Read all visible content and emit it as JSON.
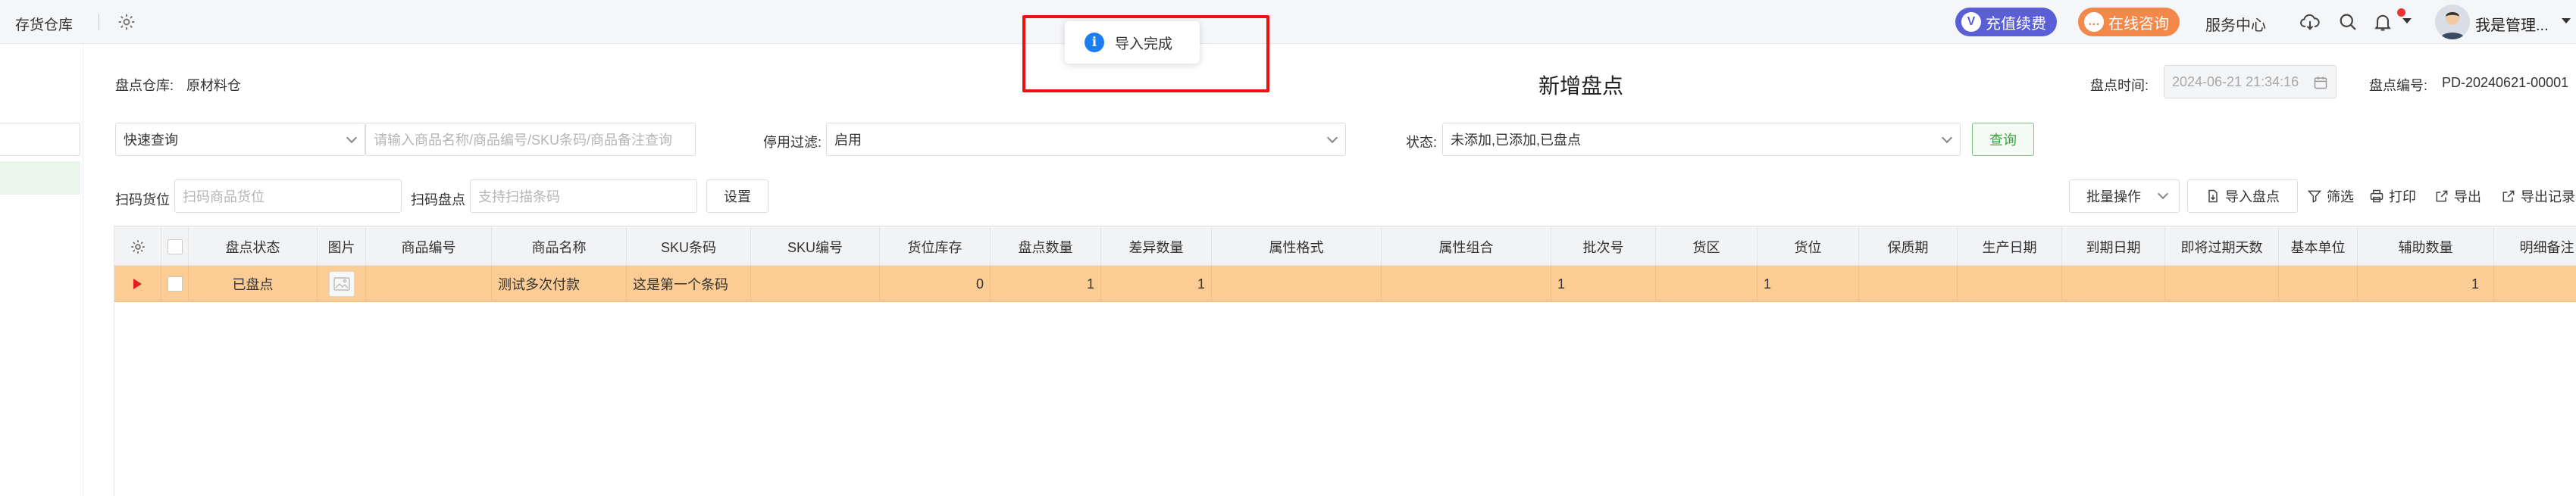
{
  "topbar": {
    "app_title": "存货仓库",
    "recharge_label": "充值续费",
    "chat_label": "在线咨询",
    "service_label": "服务中心",
    "user_name": "我是管理..."
  },
  "toast": {
    "message": "导入完成"
  },
  "header": {
    "page_title": "新增盘点",
    "warehouse_label": "盘点仓库:",
    "warehouse_value": "原材料仓",
    "time_label": "盘点时间:",
    "time_value": "2024-06-21 21:34:16",
    "code_label": "盘点编号:",
    "code_value": "PD-20240621-00001"
  },
  "filters": {
    "quick_query_value": "快速查询",
    "search_placeholder": "请输入商品名称/商品编号/SKU条码/商品备注查询",
    "disabled_filter_label": "停用过滤:",
    "disabled_filter_value": "启用",
    "status_label": "状态:",
    "status_value": "未添加,已添加,已盘点",
    "query_button": "查询"
  },
  "scan": {
    "location_label": "扫码货位",
    "location_placeholder": "扫码商品货位",
    "scan_label": "扫码盘点",
    "scan_placeholder": "支持扫描条码",
    "settings_button": "设置"
  },
  "toolbar": {
    "batch_label": "批量操作",
    "import_label": "导入盘点",
    "filter_label": "筛选",
    "print_label": "打印",
    "export_label": "导出",
    "export_record_label": "导出记录"
  },
  "table": {
    "headers": {
      "status": "盘点状态",
      "image": "图片",
      "code": "商品编号",
      "name": "商品名称",
      "sku_barcode": "SKU条码",
      "sku_code": "SKU编号",
      "stock": "货位库存",
      "count": "盘点数量",
      "diff": "差异数量",
      "attr_spec": "属性格式",
      "attr_combo": "属性组合",
      "batch": "批次号",
      "area": "货区",
      "location": "货位",
      "shelf_life": "保质期",
      "prod_date": "生产日期",
      "expire_date": "到期日期",
      "near_expire": "即将过期天数",
      "base_unit": "基本单位",
      "aux_qty": "辅助数量",
      "remark": "明细备注"
    },
    "rows": [
      {
        "status": "已盘点",
        "code": "",
        "name": "测试多次付款",
        "sku_barcode": "这是第一个条码",
        "sku_code": "",
        "stock": "0",
        "count": "1",
        "diff": "1",
        "attr_spec": "",
        "attr_combo": "",
        "batch": "1",
        "area": "",
        "location": "1",
        "shelf_life": "",
        "prod_date": "",
        "expire_date": "",
        "near_expire": "",
        "base_unit": "",
        "aux_qty": "1",
        "remark": ""
      }
    ]
  },
  "colors": {
    "accent_green": "#3aa63e",
    "row_highlight": "#fbcd95",
    "recharge": "#5a5fd6",
    "chat": "#f2894a",
    "toast_info": "#1b7ef2",
    "annotation_red": "#e11111"
  }
}
